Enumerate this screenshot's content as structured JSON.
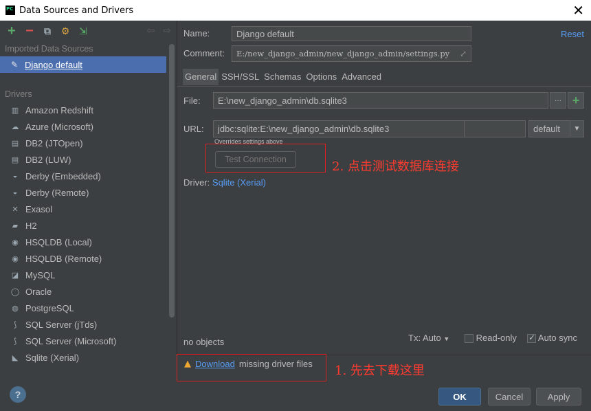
{
  "window": {
    "title": "Data Sources and Drivers",
    "close_glyph": "✕"
  },
  "left": {
    "toolbar": {
      "add": "+",
      "remove": "−",
      "copy": "⧉",
      "props": "⚙",
      "import": "⇲",
      "back": "⇦",
      "forward": "⇨"
    },
    "imported_header": "Imported Data Sources",
    "data_sources": [
      {
        "label": "Django default",
        "icon": "quill-icon"
      }
    ],
    "drivers_header": "Drivers",
    "drivers": [
      {
        "label": "Amazon Redshift",
        "icon": "redshift-icon",
        "glyph": "▥"
      },
      {
        "label": "Azure (Microsoft)",
        "icon": "azure-icon",
        "glyph": "☁"
      },
      {
        "label": "DB2 (JTOpen)",
        "icon": "ibm-icon",
        "glyph": "▤"
      },
      {
        "label": "DB2 (LUW)",
        "icon": "ibm-icon",
        "glyph": "▤"
      },
      {
        "label": "Derby (Embedded)",
        "icon": "derby-hat-icon",
        "glyph": "◒"
      },
      {
        "label": "Derby (Remote)",
        "icon": "derby-hat-icon",
        "glyph": "◒"
      },
      {
        "label": "Exasol",
        "icon": "exasol-icon",
        "glyph": "✕"
      },
      {
        "label": "H2",
        "icon": "h2-icon",
        "glyph": "▰"
      },
      {
        "label": "HSQLDB (Local)",
        "icon": "hsqldb-icon",
        "glyph": "◉"
      },
      {
        "label": "HSQLDB (Remote)",
        "icon": "hsqldb-icon",
        "glyph": "◉"
      },
      {
        "label": "MySQL",
        "icon": "mysql-icon",
        "glyph": "◪"
      },
      {
        "label": "Oracle",
        "icon": "oracle-icon",
        "glyph": "◯"
      },
      {
        "label": "PostgreSQL",
        "icon": "postgresql-icon",
        "glyph": "◍"
      },
      {
        "label": "SQL Server (jTds)",
        "icon": "sqlserver-icon",
        "glyph": "⟆"
      },
      {
        "label": "SQL Server (Microsoft)",
        "icon": "sqlserver-icon",
        "glyph": "⟆"
      },
      {
        "label": "Sqlite (Xerial)",
        "icon": "sqlite-icon",
        "glyph": "◣"
      }
    ]
  },
  "right": {
    "name_label": "Name:",
    "name_value": "Django default",
    "reset": "Reset",
    "comment_label": "Comment:",
    "comment_value": "E:/new_django_admin/new_django_admin/settings.py",
    "tabs": [
      "General",
      "SSH/SSL",
      "Schemas",
      "Options",
      "Advanced"
    ],
    "active_tab": "General",
    "file_label": "File:",
    "file_value": "E:\\new_django_admin\\db.sqlite3",
    "browse": "···",
    "url_label": "URL:",
    "url_value": "jdbc:sqlite:E:\\new_django_admin\\db.sqlite3",
    "url_mode": "default",
    "overrides_hint": "Overrides settings above",
    "test_connection": "Test Connection",
    "driver_label": "Driver:",
    "driver_value": "Sqlite (Xerial)",
    "objects_status": "no objects",
    "tx_label": "Tx: Auto",
    "readonly_label": "Read-only",
    "autosync_label": "Auto sync",
    "download_link": "Download",
    "missing_files": "missing driver files"
  },
  "footer": {
    "help": "?",
    "ok": "OK",
    "cancel": "Cancel",
    "apply": "Apply"
  },
  "annotations": {
    "step2": "2. 点击测试数据库连接",
    "step1": "1. 先去下载这里"
  }
}
